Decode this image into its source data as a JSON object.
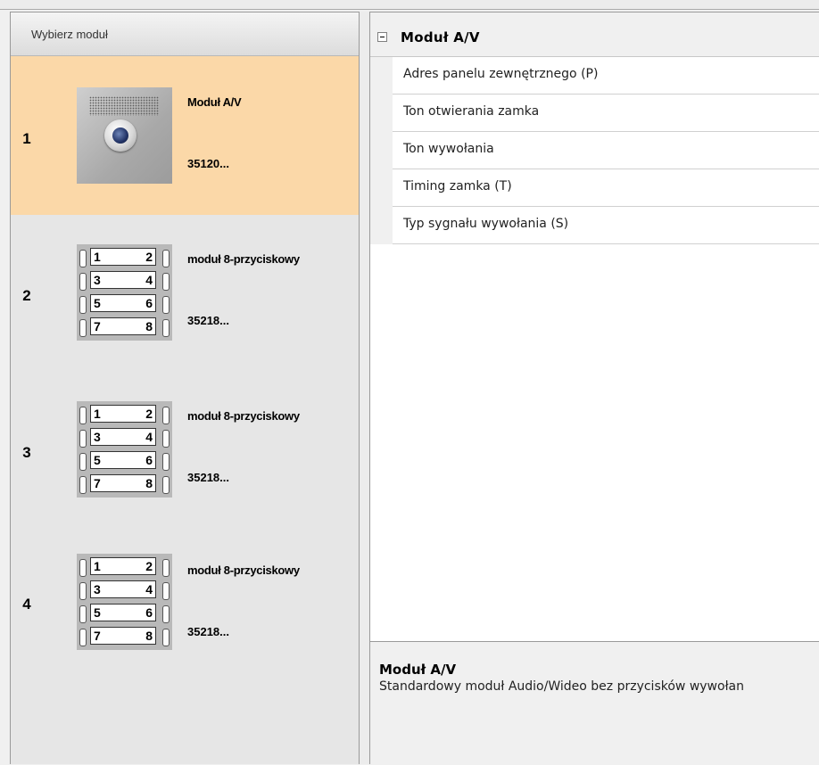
{
  "left_panel": {
    "header": "Wybierz moduł",
    "modules": [
      {
        "number": "1",
        "name": "Moduł A/V",
        "code": "35120...",
        "icon": "camera-module-icon",
        "selected": true
      },
      {
        "number": "2",
        "name": "moduł 8-przyciskowy",
        "code": "35218...",
        "icon": "keypad-8-button-icon",
        "selected": false
      },
      {
        "number": "3",
        "name": "moduł 8-przyciskowy",
        "code": "35218...",
        "icon": "keypad-8-button-icon",
        "selected": false
      },
      {
        "number": "4",
        "name": "moduł 8-przyciskowy",
        "code": "35218...",
        "icon": "keypad-8-button-icon",
        "selected": false
      }
    ],
    "keypad_labels": [
      [
        "1",
        "2"
      ],
      [
        "3",
        "4"
      ],
      [
        "5",
        "6"
      ],
      [
        "7",
        "8"
      ]
    ]
  },
  "property_grid": {
    "category": "Moduł A/V",
    "collapse_icon": "minus-collapse-icon",
    "properties": [
      "Adres panelu zewnętrznego (P)",
      "Ton otwierania zamka",
      "Ton wywołania",
      "Timing zamka (T)",
      "Typ sygnału wywołania (S)"
    ]
  },
  "description": {
    "title": "Moduł A/V",
    "text": "Standardowy moduł Audio/Wideo bez przycisków wywołan"
  },
  "colors": {
    "selected_item": "#fbd8a8",
    "panel_background": "#e6e6e6",
    "grid_background": "#ffffff"
  }
}
